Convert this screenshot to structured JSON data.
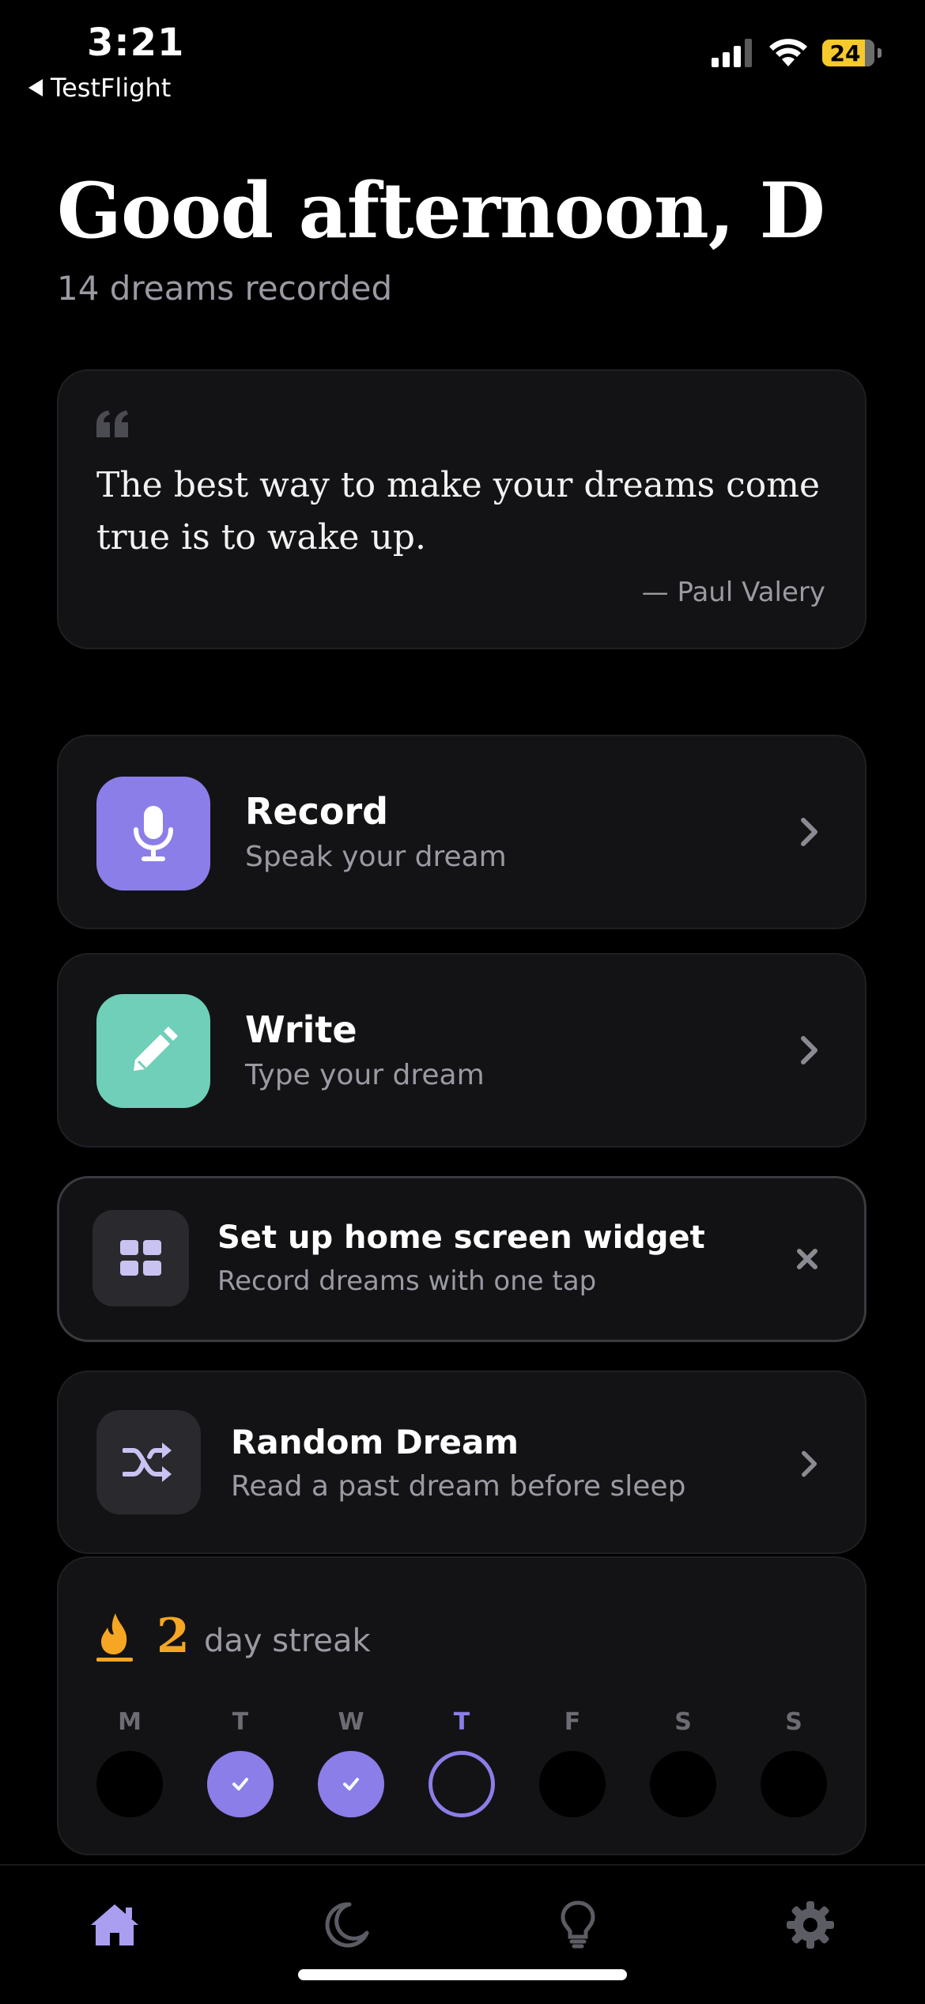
{
  "status_bar": {
    "time": "3:21",
    "back_label": "TestFlight",
    "battery": "24"
  },
  "header": {
    "greeting": "Good afternoon, D",
    "dream_count": "14 dreams recorded"
  },
  "quote": {
    "text": "The best way to make your dreams come true is to wake up.",
    "author": "— Paul Valery"
  },
  "actions": {
    "record": {
      "title": "Record",
      "subtitle": "Speak your dream",
      "icon": "microphone-icon",
      "color": "#8b7ee8"
    },
    "write": {
      "title": "Write",
      "subtitle": "Type your dream",
      "icon": "pencil-icon",
      "color": "#6fcfb8"
    }
  },
  "widget_promo": {
    "title": "Set up home screen widget",
    "subtitle": "Record dreams with one tap",
    "icon": "grid-icon"
  },
  "random_dream": {
    "title": "Random Dream",
    "subtitle": "Read a past dream before sleep",
    "icon": "shuffle-icon"
  },
  "streak": {
    "count": "2",
    "label": "day streak",
    "icon": "flame-icon",
    "days": [
      {
        "letter": "M",
        "state": "empty"
      },
      {
        "letter": "T",
        "state": "done"
      },
      {
        "letter": "W",
        "state": "done"
      },
      {
        "letter": "T",
        "state": "today"
      },
      {
        "letter": "F",
        "state": "empty"
      },
      {
        "letter": "S",
        "state": "empty"
      },
      {
        "letter": "S",
        "state": "empty"
      }
    ]
  },
  "tabs": [
    {
      "name": "home",
      "icon": "home-icon",
      "active": true
    },
    {
      "name": "dreams",
      "icon": "moon-icon",
      "active": false
    },
    {
      "name": "insights",
      "icon": "lightbulb-icon",
      "active": false
    },
    {
      "name": "settings",
      "icon": "gear-icon",
      "active": false
    }
  ],
  "colors": {
    "accent": "#8b7ee8",
    "write_accent": "#6fcfb8",
    "streak": "#f5a623",
    "card_bg": "#131315"
  }
}
